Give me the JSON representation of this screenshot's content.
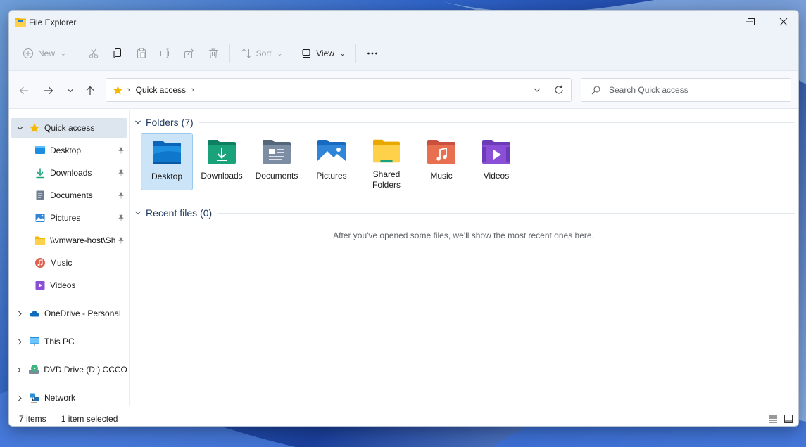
{
  "window": {
    "title": "File Explorer",
    "controls": {
      "minimize_icon": "minimize-icon",
      "maximize_icon": "maximize-icon",
      "close_icon": "close-icon"
    }
  },
  "toolbar": {
    "new_label": "New",
    "sort_label": "Sort",
    "view_label": "View",
    "icons": [
      "plus-circle-icon",
      "cut-icon",
      "copy-icon",
      "paste-icon",
      "rename-icon",
      "share-icon",
      "delete-icon",
      "sort-icon",
      "view-icon",
      "more-icon"
    ]
  },
  "navigation": {
    "address": {
      "location": "Quick access",
      "icon": "star-icon"
    },
    "search": {
      "placeholder": "Search Quick access"
    }
  },
  "sidebar": {
    "quick_access": {
      "label": "Quick access",
      "expanded": true,
      "selected": true
    },
    "pinned": [
      {
        "label": "Desktop",
        "icon": "desktop-icon",
        "pinned": true
      },
      {
        "label": "Downloads",
        "icon": "download-icon",
        "pinned": true
      },
      {
        "label": "Documents",
        "icon": "document-icon",
        "pinned": true
      },
      {
        "label": "Pictures",
        "icon": "picture-icon",
        "pinned": true
      },
      {
        "label": "\\\\vmware-host\\Sh",
        "icon": "folder-icon",
        "pinned": true
      },
      {
        "label": "Music",
        "icon": "music-icon",
        "pinned": false
      },
      {
        "label": "Videos",
        "icon": "video-icon",
        "pinned": false
      }
    ],
    "roots": [
      {
        "label": "OneDrive - Personal",
        "icon": "cloud-icon"
      },
      {
        "label": "This PC",
        "icon": "monitor-icon"
      },
      {
        "label": "DVD Drive (D:) CCCOMA",
        "icon": "dvd-drive-icon"
      },
      {
        "label": "Network",
        "icon": "network-icon"
      }
    ]
  },
  "main": {
    "folders_header": "Folders (7)",
    "folders": [
      {
        "label": "Desktop",
        "icon": "desktop-folder-icon",
        "selected": true
      },
      {
        "label": "Downloads",
        "icon": "downloads-folder-icon"
      },
      {
        "label": "Documents",
        "icon": "documents-folder-icon"
      },
      {
        "label": "Pictures",
        "icon": "pictures-folder-icon"
      },
      {
        "label": "Shared Folders",
        "icon": "shared-folder-icon"
      },
      {
        "label": "Music",
        "icon": "music-folder-icon"
      },
      {
        "label": "Videos",
        "icon": "videos-folder-icon"
      }
    ],
    "recent_header": "Recent files (0)",
    "recent_empty_message": "After you've opened some files, we'll show the most recent ones here."
  },
  "status": {
    "item_count": "7 items",
    "selection": "1 item selected",
    "view_icons": [
      "details-view-icon",
      "tiles-view-icon"
    ]
  },
  "colors": {
    "accent": "#0067c0",
    "selection_bg": "#cce4f7",
    "sidebar_selected": "#dde5ee",
    "toolbar_bg": "#eef3f9"
  }
}
